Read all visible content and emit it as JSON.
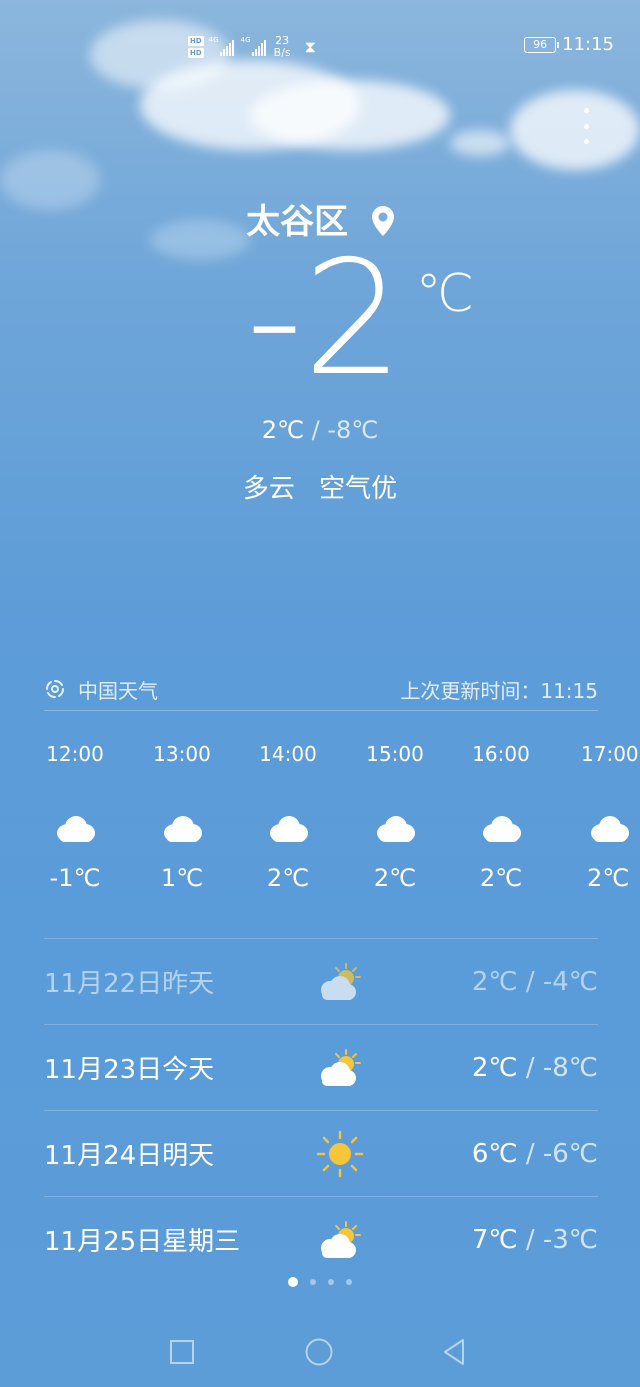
{
  "status_bar": {
    "hd_badges": [
      "HD",
      "HD"
    ],
    "network_1": "4G",
    "network_2": "4G",
    "speed_value": "23",
    "speed_unit": "B/s",
    "battery": "96",
    "time": "11:15"
  },
  "location": {
    "name": "太谷区",
    "pin_icon": "location-pin-icon"
  },
  "current": {
    "temperature": "-2",
    "unit": "℃",
    "high": "2℃",
    "low": "-8℃",
    "separator": "/",
    "condition": "多云",
    "air_quality": "空气优"
  },
  "provider": {
    "name": "中国天气",
    "update_label": "上次更新时间：11:15"
  },
  "hourly": [
    {
      "time": "12:00",
      "icon": "cloud-icon",
      "temp": "-1℃"
    },
    {
      "time": "13:00",
      "icon": "cloud-icon",
      "temp": "1℃"
    },
    {
      "time": "14:00",
      "icon": "cloud-icon",
      "temp": "2℃"
    },
    {
      "time": "15:00",
      "icon": "cloud-icon",
      "temp": "2℃"
    },
    {
      "time": "16:00",
      "icon": "cloud-icon",
      "temp": "2℃"
    },
    {
      "time": "17:00",
      "icon": "cloud-icon",
      "temp": "2℃"
    }
  ],
  "daily": [
    {
      "date": "11月22日昨天",
      "icon": "partly-cloudy-icon",
      "high": "2℃",
      "low": "-4℃",
      "past": true
    },
    {
      "date": "11月23日今天",
      "icon": "partly-cloudy-icon",
      "high": "2℃",
      "low": "-8℃",
      "past": false
    },
    {
      "date": "11月24日明天",
      "icon": "sun-icon",
      "high": "6℃",
      "low": "-6℃",
      "past": false
    },
    {
      "date": "11月25日星期三",
      "icon": "partly-cloudy-icon",
      "high": "7℃",
      "low": "-3℃",
      "past": false
    }
  ],
  "pager": {
    "count": 4,
    "active": 0
  },
  "colors": {
    "sky_top": "#8cb6dc",
    "sky_bottom": "#5c9dd8",
    "sun": "#f7c53a"
  }
}
